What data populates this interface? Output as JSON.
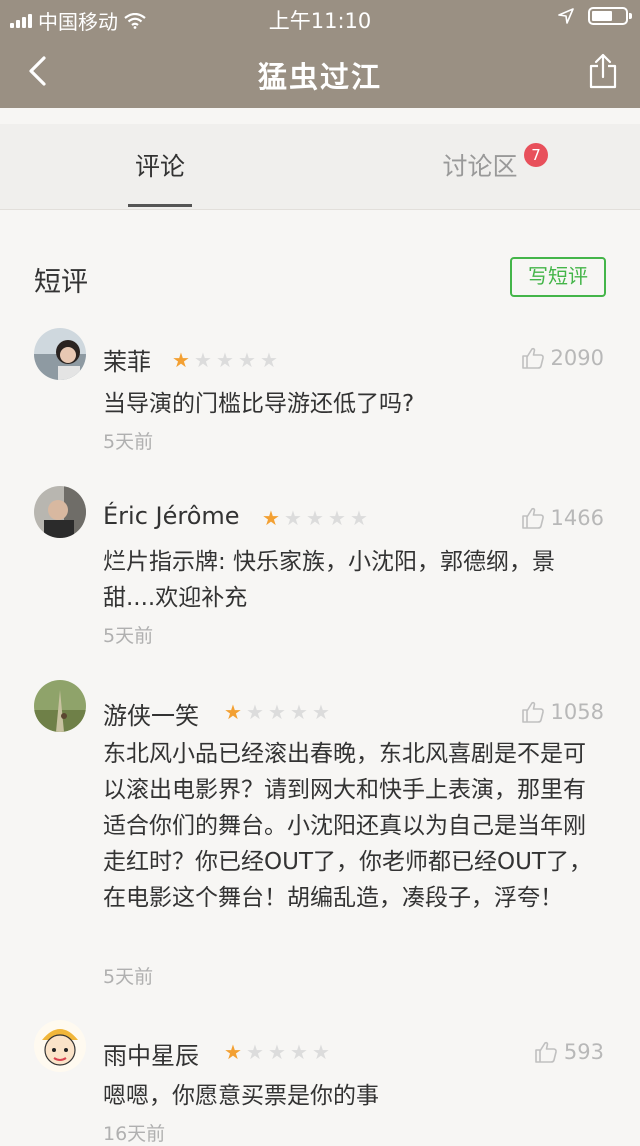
{
  "status_bar": {
    "carrier": "中国移动",
    "time": "上午11:10"
  },
  "nav": {
    "title": "猛虫过江"
  },
  "tabs": [
    {
      "label": "评论"
    },
    {
      "label": "讨论区",
      "badge": "7"
    }
  ],
  "section": {
    "title": "短评",
    "write_label": "写短评"
  },
  "reviews": [
    {
      "name": "茉菲",
      "rating": 1,
      "likes": "2090",
      "text": "当导演的门槛比导游还低了吗?",
      "time": "5天前"
    },
    {
      "name": "Éric Jérôme",
      "rating": 1,
      "likes": "1466",
      "text": "烂片指示牌: 快乐家族，小沈阳，郭德纲，景甜....欢迎补充",
      "time": "5天前"
    },
    {
      "name": "游侠一笑",
      "rating": 1,
      "likes": "1058",
      "text": "东北风小品已经滚出春晚，东北风喜剧是不是可以滚出电影界？请到网大和快手上表演，那里有适合你们的舞台。小沈阳还真以为自己是当年刚走红时？你已经OUT了，你老师都已经OUT了，在电影这个舞台！胡编乱造，凑段子，浮夸！",
      "time": "5天前"
    },
    {
      "name": "雨中星辰",
      "rating": 1,
      "likes": "593",
      "text": "嗯嗯，你愿意买票是你的事",
      "time": "16天前"
    }
  ],
  "colors": {
    "header": "#9a9083",
    "accent_green": "#44b549",
    "star_on": "#f3a032",
    "badge": "#e8505b"
  }
}
